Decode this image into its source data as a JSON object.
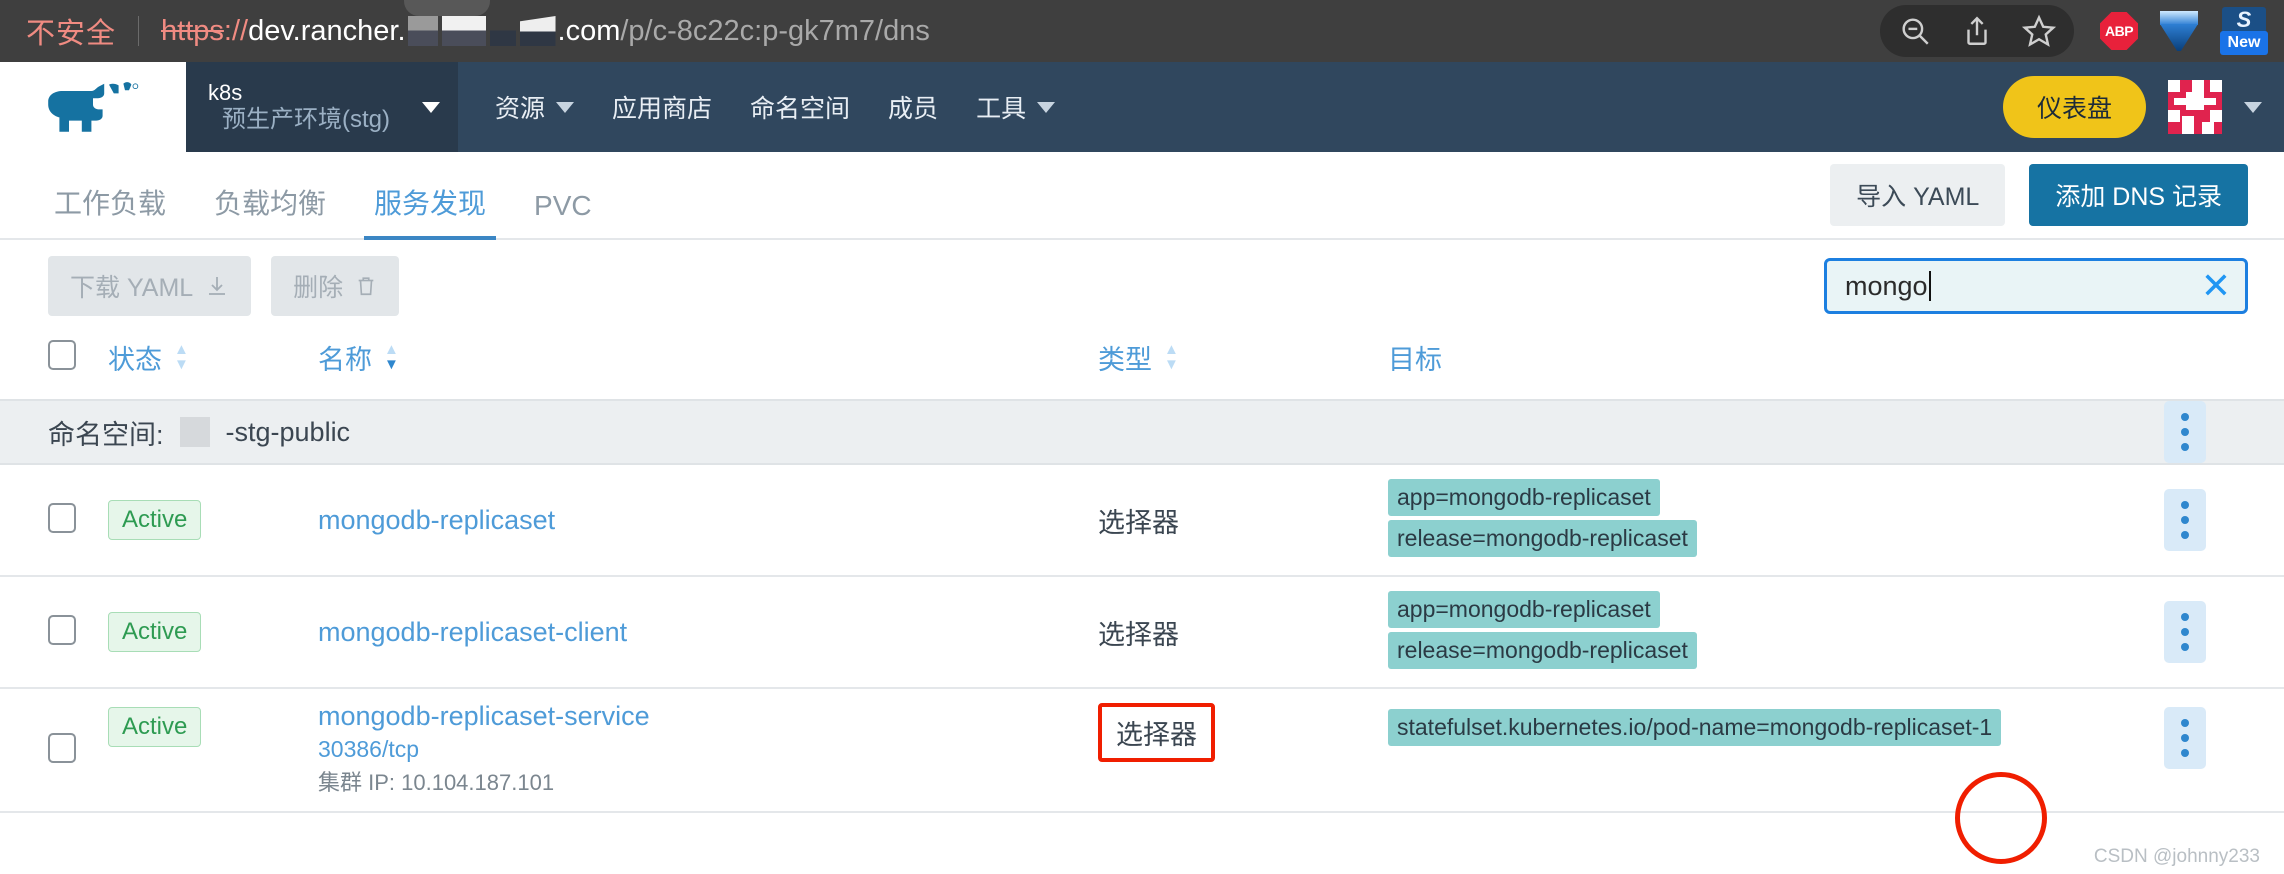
{
  "browser": {
    "security_label": "不安全",
    "url": {
      "scheme_struck": "https",
      "scheme_sep": "://",
      "host_visible": "dev.rancher.",
      "host_tld": ".com",
      "path": "/p/c-8c22c:p-gk7m7/dns",
      "redacted": true
    },
    "toolbar_icons": [
      "zoom-out-icon",
      "share-icon",
      "bookmark-star-icon"
    ],
    "extensions": [
      {
        "name": "adblock-plus-icon",
        "label": "ABP",
        "color": "#e8213b"
      },
      {
        "name": "gem-icon",
        "label": "",
        "color": "#2e7fd4"
      },
      {
        "name": "new-extension-icon",
        "label": "New",
        "glyph": "S",
        "color": "#1a73e8"
      }
    ]
  },
  "header": {
    "logo_name": "rancher-cow-logo",
    "logo_color": "#1572a1",
    "cluster": {
      "name": "k8s",
      "environment": "预生产环境(stg)"
    },
    "nav": [
      {
        "label": "资源",
        "has_chevron": true
      },
      {
        "label": "应用商店",
        "has_chevron": false
      },
      {
        "label": "命名空间",
        "has_chevron": false
      },
      {
        "label": "成员",
        "has_chevron": false
      },
      {
        "label": "工具",
        "has_chevron": true
      }
    ],
    "dashboard_button": "仪表盘",
    "dashboard_color": "#f0c419",
    "avatar_name": "user-avatar-identicon",
    "avatar_color": "#e0234e"
  },
  "tabs": [
    {
      "label": "工作负载",
      "active": false
    },
    {
      "label": "负载均衡",
      "active": false
    },
    {
      "label": "服务发现",
      "active": true
    },
    {
      "label": "PVC",
      "active": false
    }
  ],
  "tab_actions": {
    "import_yaml": "导入 YAML",
    "add_dns": "添加 DNS 记录",
    "primary_color": "#1673a3"
  },
  "toolbar": {
    "download_yaml": "下载 YAML",
    "delete": "删除",
    "download_icon": "download-icon",
    "delete_icon": "trash-icon"
  },
  "search": {
    "value": "mongo",
    "placeholder": "",
    "clear_icon": "close-x-icon",
    "border_color": "#1c7fe0",
    "background": "#e9f4f6"
  },
  "table": {
    "columns": [
      {
        "label": "状态",
        "sortable": true,
        "sort_state": "none"
      },
      {
        "label": "名称",
        "sortable": true,
        "sort_state": "desc"
      },
      {
        "label": "类型",
        "sortable": true,
        "sort_state": "none"
      },
      {
        "label": "目标",
        "sortable": false,
        "sort_state": "none"
      }
    ],
    "group": {
      "label": "命名空间:",
      "value": "-stg-public",
      "redacted_prefix": true
    },
    "rows": [
      {
        "status": "Active",
        "name": "mongodb-replicaset",
        "port": "",
        "cluster_ip": "",
        "type": "选择器",
        "type_highlighted": false,
        "targets": [
          "app=mongodb-replicaset",
          "release=mongodb-replicaset"
        ]
      },
      {
        "status": "Active",
        "name": "mongodb-replicaset-client",
        "port": "",
        "cluster_ip": "",
        "type": "选择器",
        "type_highlighted": false,
        "targets": [
          "app=mongodb-replicaset",
          "release=mongodb-replicaset"
        ]
      },
      {
        "status": "Active",
        "name": "mongodb-replicaset-service",
        "port": "30386/tcp",
        "cluster_ip": "集群 IP: 10.104.187.101",
        "type": "选择器",
        "type_highlighted": true,
        "targets": [
          "statefulset.kubernetes.io/pod-name=mongodb-replicaset-1"
        ]
      }
    ],
    "status_badge_color": "#2e9b52",
    "link_color": "#4e9bd8",
    "tag_color": "#8cd0cf",
    "kebab_icon": "more-vertical-icon"
  },
  "annotations": {
    "highlight_color": "#f01e00",
    "ellipse_target": "-1 suffix on pod-name selector"
  },
  "watermark": "CSDN @johnny233"
}
